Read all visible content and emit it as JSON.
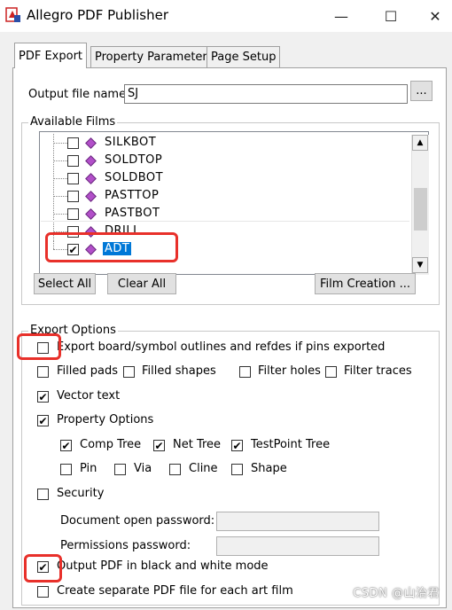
{
  "window": {
    "title": "Allegro PDF Publisher",
    "app_icon": "pdf-publisher-app-icon",
    "controls": {
      "minimize": "—",
      "maximize": "☐",
      "close": "✕"
    }
  },
  "tabs": [
    {
      "label": "PDF Export",
      "active": true
    },
    {
      "label": "Property Parameters",
      "active": false
    },
    {
      "label": "Page Setup",
      "active": false
    }
  ],
  "output": {
    "label": "Output file name:",
    "value": "SJ",
    "browse_label": "..."
  },
  "films": {
    "title": "Available Films",
    "items": [
      {
        "label": "SILKBOT",
        "checked": false
      },
      {
        "label": "SOLDTOP",
        "checked": false
      },
      {
        "label": "SOLDBOT",
        "checked": false
      },
      {
        "label": "PASTTOP",
        "checked": false
      },
      {
        "label": "PASTBOT",
        "checked": false
      },
      {
        "label": "DRILL",
        "checked": false
      },
      {
        "label": "ADT",
        "checked": true,
        "selected": true
      }
    ],
    "buttons": {
      "select_all": "Select All",
      "clear_all": "Clear All",
      "film_creation": "Film Creation ..."
    }
  },
  "export_options": {
    "title": "Export Options",
    "board_outlines": {
      "label": "Export board/symbol outlines and refdes if pins exported",
      "checked": false
    },
    "filled_pads": {
      "label": "Filled pads",
      "checked": false
    },
    "filled_shapes": {
      "label": "Filled shapes",
      "checked": false
    },
    "filter_holes": {
      "label": "Filter holes",
      "checked": false
    },
    "filter_traces": {
      "label": "Filter traces",
      "checked": false
    },
    "vector_text": {
      "label": "Vector text",
      "checked": true
    },
    "property_options": {
      "label": "Property Options",
      "checked": true
    },
    "comp_tree": {
      "label": "Comp Tree",
      "checked": true
    },
    "net_tree": {
      "label": "Net Tree",
      "checked": true
    },
    "testpoint_tree": {
      "label": "TestPoint Tree",
      "checked": true
    },
    "pin": {
      "label": "Pin",
      "checked": false
    },
    "via": {
      "label": "Via",
      "checked": false
    },
    "cline": {
      "label": "Cline",
      "checked": false
    },
    "shape": {
      "label": "Shape",
      "checked": false
    },
    "security": {
      "label": "Security",
      "checked": false
    },
    "doc_open_pw_label": "Document open password:",
    "permissions_pw_label": "Permissions password:",
    "black_white": {
      "label": "Output PDF in black and white mode",
      "checked": true
    },
    "separate_pdf": {
      "label": "Create separate PDF file for each art film",
      "checked": false
    }
  },
  "watermark": "CSDN @山治君",
  "colors": {
    "highlight": "#e8302a",
    "selection": "#0078d7",
    "diamond": "#b24fc9"
  }
}
